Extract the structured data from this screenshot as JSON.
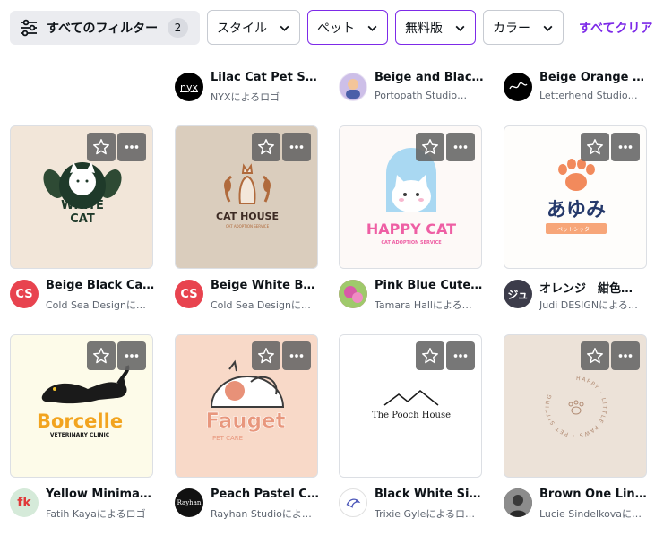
{
  "filters": {
    "all_filters_label": "すべてのフィルター",
    "all_filters_count": "2",
    "dropdowns": [
      {
        "label": "スタイル",
        "active": false
      },
      {
        "label": "ペット",
        "active": true
      },
      {
        "label": "無料版",
        "active": true
      },
      {
        "label": "カラー",
        "active": false
      }
    ],
    "clear_all": "すべてクリア"
  },
  "colors": {
    "accent": "#7d2ae8",
    "cold_sea_avatar": "#e8434f"
  },
  "row0": [
    {
      "title": "",
      "author": ""
    },
    {
      "title": "Lilac Cat Pet Sh…",
      "author": "NYXによるロゴ",
      "avatar_text": "nyx"
    },
    {
      "title": "Beige and Black…",
      "author": "Portopath Studio…"
    },
    {
      "title": "Beige Orange C…",
      "author": "Letterhend Studio…"
    }
  ],
  "row1": [
    {
      "title": "Beige Black Cat …",
      "author": "Cold Sea Designに…",
      "avatar_text": "CS",
      "art_lines": [
        "WHITE",
        "CAT"
      ]
    },
    {
      "title": "Beige White Bro…",
      "author": "Cold Sea Designに…",
      "avatar_text": "CS",
      "art_lines": [
        "CAT HOUSE",
        "CAT ADOPTION SERVICE"
      ]
    },
    {
      "title": "Pink Blue Cute I…",
      "author": "Tamara Hallによる…",
      "art_lines": [
        "HAPPY CAT",
        "CAT ADOPTION SERVICE"
      ]
    },
    {
      "title": "オレンジ　紺色…",
      "author": "Judi DESIGNによる…",
      "avatar_text": "ジュ",
      "art_lines": [
        "あゆみ",
        "ペットシッター"
      ]
    }
  ],
  "row2": [
    {
      "title": "Yellow Minimali…",
      "author": "Fatih Kayaによるロゴ",
      "avatar_text": "fk",
      "art_lines": [
        "Borcelle",
        "VETERINARY CLINIC"
      ]
    },
    {
      "title": "Peach Pastel Cu…",
      "author": "Rayhan Studioによ…",
      "avatar_text": "Rayhan",
      "art_lines": [
        "Fauget",
        "PET CARE"
      ]
    },
    {
      "title": "Black White Si…",
      "author": "Trixie Gyleによるロ…",
      "art_lines": [
        "The Pooch House"
      ]
    },
    {
      "title": "Brown One Line…",
      "author": "Lucie Sindelkovaに…",
      "art_lines": [
        "HAPPY · LITTLE PAWS · PET SITTING"
      ]
    }
  ]
}
